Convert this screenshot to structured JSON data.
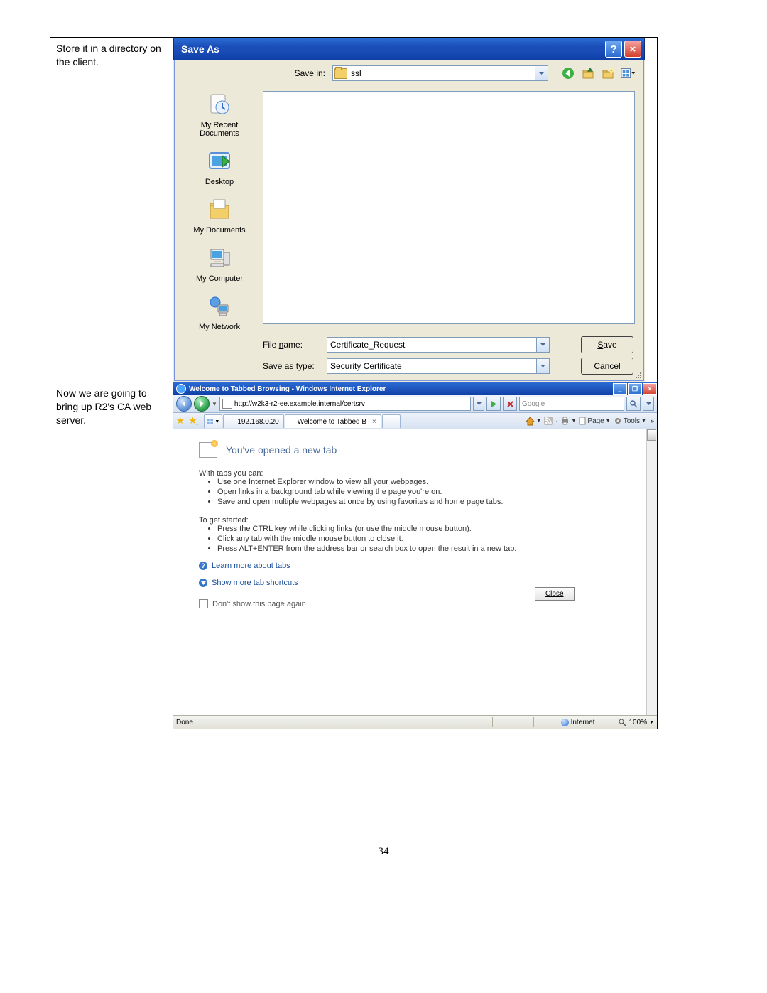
{
  "page_number": "34",
  "row1": {
    "caption": "Store it in a directory on the client.",
    "saveas": {
      "title": "Save As",
      "savein_label": "Save in:",
      "savein_value": "ssl",
      "places": {
        "recent": "My Recent Documents",
        "desktop": "Desktop",
        "mydocs": "My Documents",
        "mycomp": "My Computer",
        "mynet": "My Network"
      },
      "filename_label": "File name:",
      "filename_value": "Certificate_Request",
      "type_label": "Save as type:",
      "type_value": "Security Certificate",
      "save_btn": "Save",
      "cancel_btn": "Cancel"
    }
  },
  "row2": {
    "caption": "Now we are going to bring up R2's CA web server.",
    "ie": {
      "title": "Welcome to Tabbed Browsing - Windows Internet Explorer",
      "address": "http://w2k3-r2-ee.example.internal/certsrv",
      "search_placeholder": "Google",
      "fav_link": "192.168.0.20",
      "tab_active": "Welcome to Tabbed Brow…",
      "cmd_page": "Page",
      "cmd_tools": "Tools",
      "nt_title": "You've opened a new tab",
      "with_tabs": "With tabs you can:",
      "with_list": [
        "Use one Internet Explorer window to view all your webpages.",
        "Open links in a background tab while viewing the page you're on.",
        "Save and open multiple webpages at once by using favorites and home page tabs."
      ],
      "started": "To get started:",
      "started_list": [
        "Press the CTRL key while clicking links (or use the middle mouse button).",
        "Click any tab with the middle mouse button to close it.",
        "Press ALT+ENTER from the address bar or search box to open the result in a new tab."
      ],
      "learn_more": "Learn more about tabs",
      "show_more": "Show more tab shortcuts",
      "dont_show": "Don't show this page again",
      "close_btn": "Close",
      "status_left": "Done",
      "zone": "Internet",
      "zoom": "100%"
    }
  }
}
